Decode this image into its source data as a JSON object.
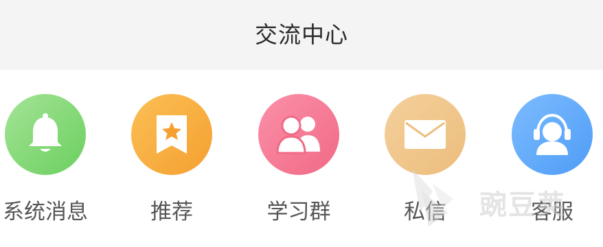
{
  "header": {
    "title": "交流中心"
  },
  "items": [
    {
      "label": "系统消息",
      "icon": "bell-icon",
      "color": "#7fd46f"
    },
    {
      "label": "推荐",
      "icon": "star-bookmark-icon",
      "color": "#f7ab3c"
    },
    {
      "label": "学习群",
      "icon": "group-icon",
      "color": "#f47892"
    },
    {
      "label": "私信",
      "icon": "envelope-icon",
      "color": "#f0c588"
    },
    {
      "label": "客服",
      "icon": "headset-agent-icon",
      "color": "#5ea8fa"
    }
  ],
  "watermark": {
    "text": "豌豆荚"
  }
}
